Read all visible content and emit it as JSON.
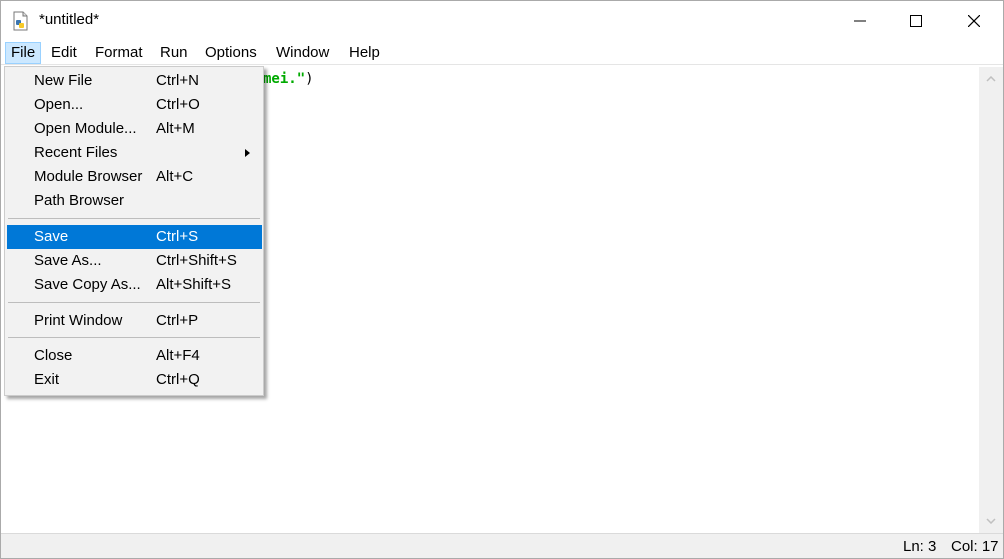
{
  "window": {
    "title": "*untitled*",
    "minimize_glyph": "—",
    "maximize_glyph": "☐",
    "close_glyph": "✕"
  },
  "menubar": {
    "items": [
      "File",
      "Edit",
      "Format",
      "Run",
      "Options",
      "Window",
      "Help"
    ],
    "active": "File"
  },
  "editor": {
    "visible_code_string": "mei.\"",
    "visible_code_tail": ")"
  },
  "file_menu": {
    "items": [
      {
        "label": "New File",
        "shortcut": "Ctrl+N"
      },
      {
        "label": "Open...",
        "shortcut": "Ctrl+O"
      },
      {
        "label": "Open Module...",
        "shortcut": "Alt+M"
      },
      {
        "label": "Recent Files",
        "shortcut": "",
        "submenu": true
      },
      {
        "label": "Module Browser",
        "shortcut": "Alt+C"
      },
      {
        "label": "Path Browser",
        "shortcut": ""
      },
      {
        "label": "Save",
        "shortcut": "Ctrl+S",
        "highlighted": true
      },
      {
        "label": "Save As...",
        "shortcut": "Ctrl+Shift+S"
      },
      {
        "label": "Save Copy As...",
        "shortcut": "Alt+Shift+S"
      },
      {
        "label": "Print Window",
        "shortcut": "Ctrl+P"
      },
      {
        "label": "Close",
        "shortcut": "Alt+F4"
      },
      {
        "label": "Exit",
        "shortcut": "Ctrl+Q"
      }
    ]
  },
  "statusbar": {
    "line": "Ln: 3",
    "column": "Col: 17"
  },
  "colors": {
    "highlight": "#0078d7",
    "string_green": "#00aa00",
    "menu_active_bg": "#cce8ff"
  }
}
